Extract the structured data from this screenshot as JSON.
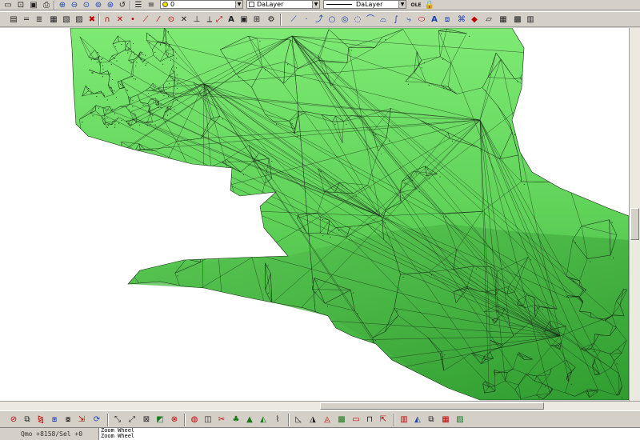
{
  "toolbar_top": {
    "layer_value": "0",
    "color_value": "DaLayer",
    "linetype_value": "DaLayer",
    "ole_label": "OLE"
  },
  "toolbar_second": {
    "text_tool_label": "A",
    "text_tool_label_2": "A"
  },
  "status": {
    "coordinates": "Qmo +8158/Sel +0"
  },
  "command_log": [
    "Zoom Wheel",
    "Zoom Wheel"
  ],
  "colors": {
    "terrain_light": "#7eea74",
    "terrain_mid": "#4fc44a",
    "terrain_dark": "#2e9a2e",
    "mesh_line": "#1a2a1a",
    "ui_face": "#d4d0c8"
  }
}
